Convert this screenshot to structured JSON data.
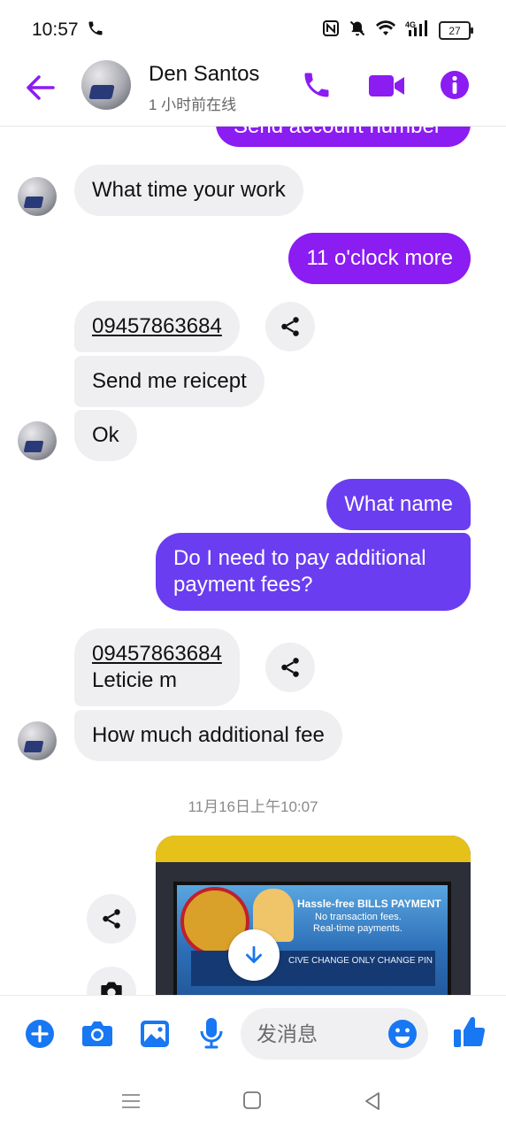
{
  "status_bar": {
    "time": "10:57",
    "battery": "27",
    "icons": [
      "phone-call-icon",
      "nfc-icon",
      "mute-bell-icon",
      "wifi-icon",
      "4g-signal-icon",
      "battery-icon"
    ]
  },
  "header": {
    "contact_name": "Den Santos",
    "contact_status": "1 小时前在线",
    "icons": [
      "back-arrow-icon",
      "phone-icon",
      "video-icon",
      "info-icon"
    ]
  },
  "messages": {
    "top_partial": "Send account number",
    "m1": "What time your work",
    "m2": "11 o'clock more",
    "m3": "09457863684",
    "m4": "Send me reicept",
    "m5": "Ok",
    "m6": "What name",
    "m7_line1": "Do I need to pay additional",
    "m7_line2": "payment fees?",
    "m8_line1": "09457863684",
    "m8_line2": "Leticie m",
    "m9": "How much additional fee",
    "timestamp": "11月16日上午10:07",
    "photo_text_title": "Hassle-free BILLS PAYMENT",
    "photo_text_line1": "No transaction fees.",
    "photo_text_line2": "Real-time payments.",
    "photo_text_strip": "CIVE CHANGE ONLY CHANGE PIN"
  },
  "composer": {
    "placeholder": "发消息",
    "icons": [
      "plus-icon",
      "camera-icon",
      "gallery-icon",
      "mic-icon",
      "emoji-icon",
      "thumbs-up-icon"
    ]
  },
  "nav_bar": {
    "icons": [
      "menu-icon",
      "home-icon",
      "back-icon"
    ]
  },
  "colors": {
    "accent": "#8b1cf2",
    "outgoing_dark": "#6a3df0",
    "incoming": "#efeff2",
    "composer_blue": "#1877f2"
  }
}
